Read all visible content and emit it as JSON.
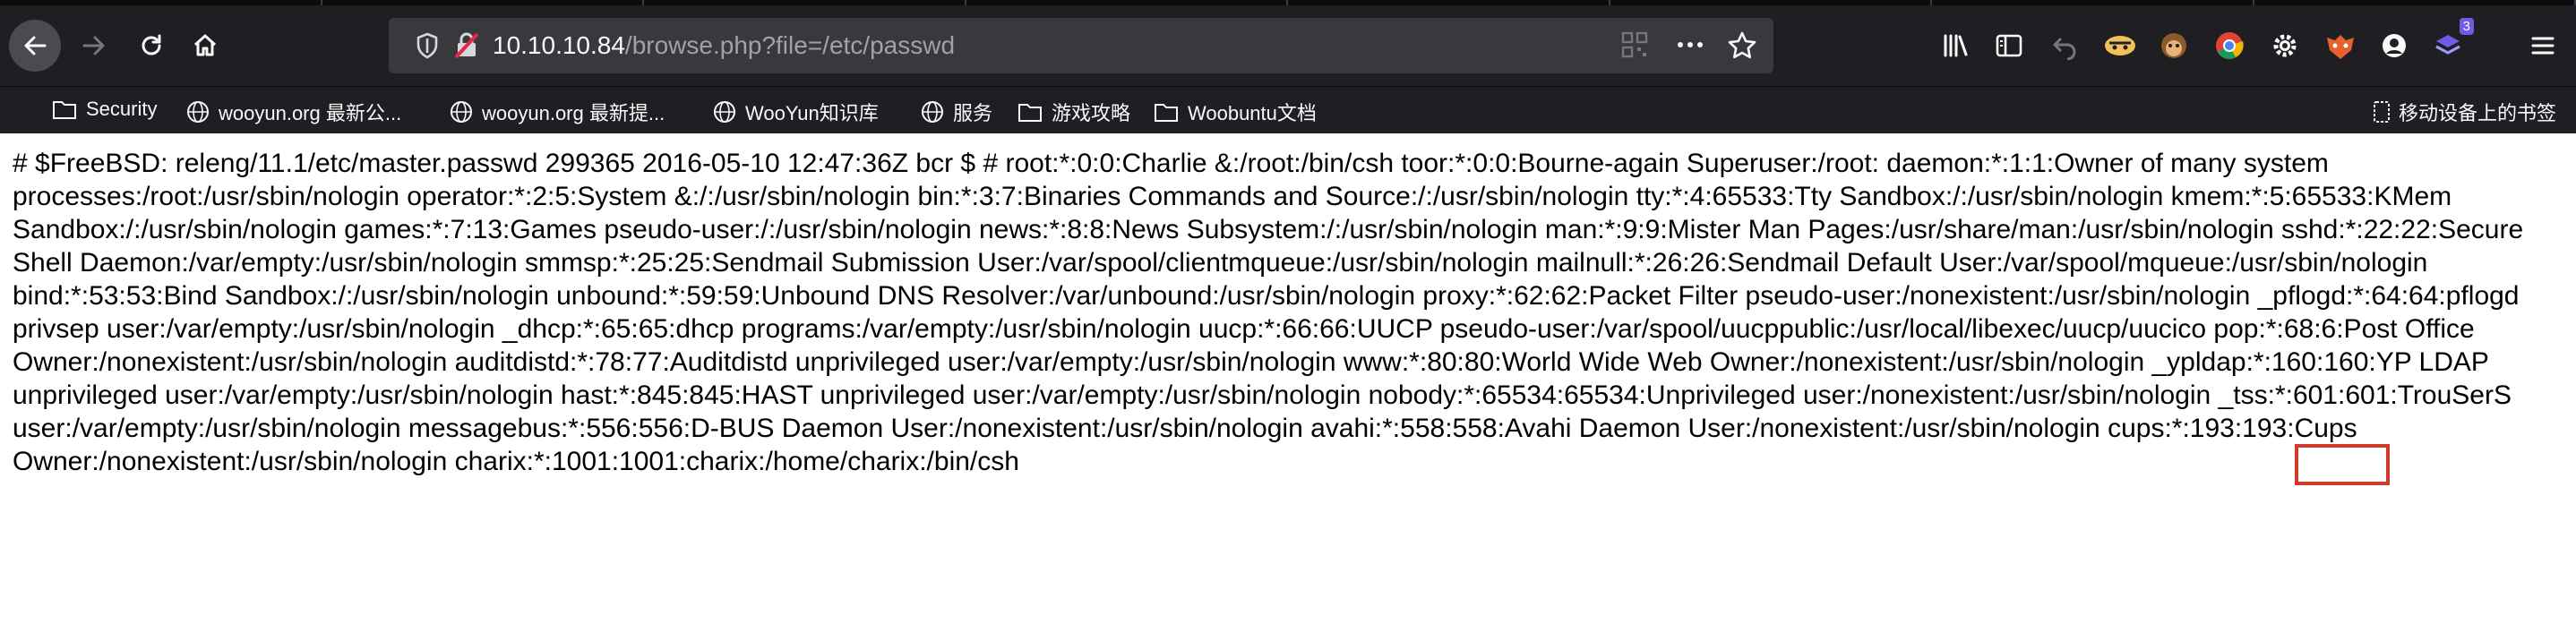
{
  "browser": {
    "url_host": "10.10.10.84",
    "url_path": "/browse.php?file=/etc/passwd",
    "extension_badge": "3"
  },
  "bookmarks": [
    {
      "label": "Security",
      "icon": "folder-icon"
    },
    {
      "label": "wooyun.org 最新公...",
      "icon": "globe-icon"
    },
    {
      "label": "wooyun.org 最新提...",
      "icon": "globe-icon"
    },
    {
      "label": "WooYun知识库",
      "icon": "globe-icon"
    },
    {
      "label": "服务",
      "icon": "globe-icon"
    },
    {
      "label": "游戏攻略",
      "icon": "folder-icon"
    },
    {
      "label": "Woobuntu文档",
      "icon": "folder-icon"
    }
  ],
  "mobile_bookmarks": "移动设备上的书签",
  "page": {
    "body_text": "# $FreeBSD: releng/11.1/etc/master.passwd 299365 2016-05-10 12:47:36Z bcr $ # root:*:0:0:Charlie &:/root:/bin/csh toor:*:0:0:Bourne-again Superuser:/root: daemon:*:1:1:Owner of many system processes:/root:/usr/sbin/nologin operator:*:2:5:System &:/:/usr/sbin/nologin bin:*:3:7:Binaries Commands and Source:/:/usr/sbin/nologin tty:*:4:65533:Tty Sandbox:/:/usr/sbin/nologin kmem:*:5:65533:KMem Sandbox:/:/usr/sbin/nologin games:*:7:13:Games pseudo-user:/:/usr/sbin/nologin news:*:8:8:News Subsystem:/:/usr/sbin/nologin man:*:9:9:Mister Man Pages:/usr/share/man:/usr/sbin/nologin sshd:*:22:22:Secure Shell Daemon:/var/empty:/usr/sbin/nologin smmsp:*:25:25:Sendmail Submission User:/var/spool/clientmqueue:/usr/sbin/nologin mailnull:*:26:26:Sendmail Default User:/var/spool/mqueue:/usr/sbin/nologin bind:*:53:53:Bind Sandbox:/:/usr/sbin/nologin unbound:*:59:59:Unbound DNS Resolver:/var/unbound:/usr/sbin/nologin proxy:*:62:62:Packet Filter pseudo-user:/nonexistent:/usr/sbin/nologin _pflogd:*:64:64:pflogd privsep user:/var/empty:/usr/sbin/nologin _dhcp:*:65:65:dhcp programs:/var/empty:/usr/sbin/nologin uucp:*:66:66:UUCP pseudo-user:/var/spool/uucppublic:/usr/local/libexec/uucp/uucico pop:*:68:6:Post Office Owner:/nonexistent:/usr/sbin/nologin auditdistd:*:78:77:Auditdistd unprivileged user:/var/empty:/usr/sbin/nologin www:*:80:80:World Wide Web Owner:/nonexistent:/usr/sbin/nologin _ypldap:*:160:160:YP LDAP unprivileged user:/var/empty:/usr/sbin/nologin hast:*:845:845:HAST unprivileged user:/var/empty:/usr/sbin/nologin nobody:*:65534:65534:Unprivileged user:/nonexistent:/usr/sbin/nologin _tss:*:601:601:TrouSerS user:/var/empty:/usr/sbin/nologin messagebus:*:556:556:D-BUS Daemon User:/nonexistent:/usr/sbin/nologin avahi:*:558:558:Avahi Daemon User:/nonexistent:/usr/sbin/nologin cups:*:193:193:Cups Owner:/nonexistent:/usr/sbin/nologin charix:*:1001:1001:charix:/home/charix:/bin/csh"
  },
  "colors": {
    "toolbar_bg": "#1f1e22",
    "urlbar_bg": "#38383d",
    "highlight": "#d43a2a"
  }
}
